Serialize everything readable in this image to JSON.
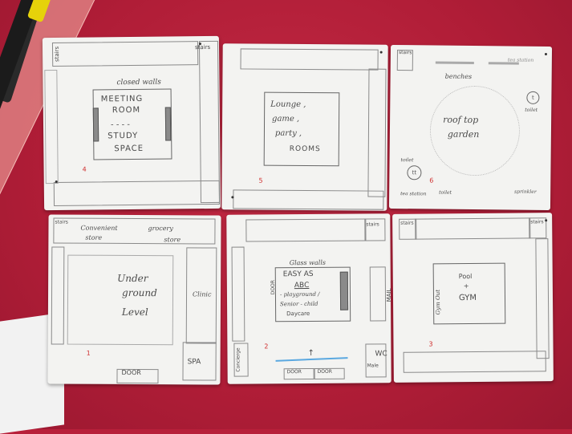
{
  "cards": [
    {
      "id": "4",
      "number": "4",
      "labels": {
        "stairs": "stairs",
        "walls": "closed walls",
        "room_line1": "MEETING",
        "room_line2": "ROOM",
        "room_line3": "STUDY",
        "room_line4": "SPACE"
      }
    },
    {
      "id": "5",
      "number": "5",
      "labels": {
        "room_line1": "Lounge ,",
        "room_line2": "game ,",
        "room_line3": "party ,",
        "room_line4": "ROOMS"
      }
    },
    {
      "id": "6",
      "number": "6",
      "labels": {
        "stairs": "stairs",
        "benches": "benches",
        "tea_station_top": "tea station",
        "rooftop1": "roof top",
        "rooftop2": "garden",
        "toilet_right": "toilet",
        "toilet_left": "toilet",
        "toilet_bottom": "toilet",
        "tea_station_bottom": "tea station",
        "sprinkler": "sprinkler"
      }
    },
    {
      "id": "1",
      "number": "1",
      "labels": {
        "stairs": "stairs",
        "convenient1": "Convenient",
        "convenient2": "store",
        "grocery1": "grocery",
        "grocery2": "store",
        "under1": "Under",
        "under2": "ground",
        "under3": "Level",
        "clinic": "Clinic",
        "spa": "SPA",
        "door": "DOOR"
      }
    },
    {
      "id": "2",
      "number": "2",
      "labels": {
        "stairs": "stairs",
        "glass": "Glass walls",
        "easy": "EASY AS",
        "abc": "ABC",
        "play": "- playground /",
        "senior": "Senior - child",
        "daycare": "Daycare",
        "door": "DOOR",
        "mail": "MAIL",
        "concierge": "Concierge",
        "male": "Male",
        "wc": "WC",
        "door_b1": "DOOR",
        "door_b2": "DOOR"
      }
    },
    {
      "id": "3",
      "number": "3",
      "labels": {
        "stairs_left": "stairs",
        "stairs_right": "stairs",
        "gym_out": "Gym Out",
        "pool": "Pool",
        "plus": "+",
        "gym": "GYM"
      }
    }
  ],
  "colors": {
    "table": "#b8203a",
    "paper": "#f3f3f1",
    "pencil": "#4a4a4a",
    "number": "#d03030",
    "blue_line": "#5aa8e0"
  }
}
